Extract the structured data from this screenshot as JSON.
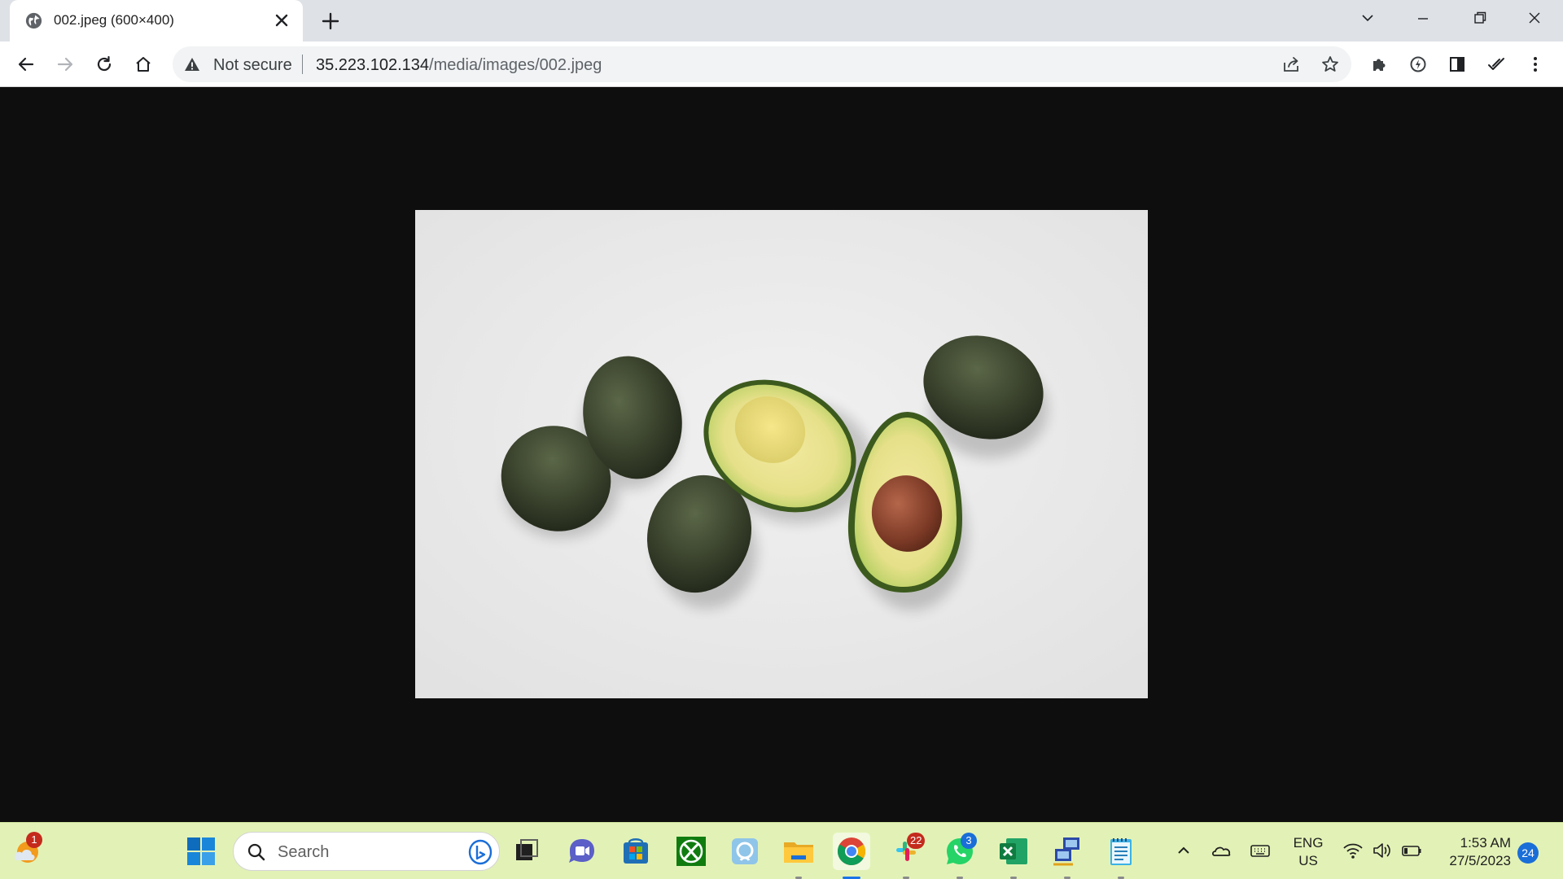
{
  "browser": {
    "tab": {
      "title": "002.jpeg (600×400)",
      "favicon": "globe-icon"
    },
    "omnibox": {
      "security_label": "Not secure",
      "url_host": "35.223.102.134",
      "url_path": "/media/images/002.jpeg"
    },
    "toolbar_icons": [
      "back-arrow-icon",
      "forward-arrow-icon",
      "reload-icon",
      "home-icon",
      "share-icon",
      "star-icon",
      "puzzle-extensions-icon",
      "lightning-extension-icon",
      "side-panel-icon",
      "checkmark-extension-icon",
      "kebab-menu-icon"
    ]
  },
  "content": {
    "image_description_icon": "avocado-photo"
  },
  "taskbar": {
    "weather_badge": "1",
    "search_label": "Search",
    "apps": [
      "windows-start-icon",
      "task-view-icon",
      "teams-chat-icon",
      "microsoft-store-icon",
      "xbox-icon",
      "photos-icon",
      "file-explorer-icon",
      "chrome-icon",
      "slack-icon",
      "whatsapp-icon",
      "excel-icon",
      "network-app-icon",
      "notepad-icon"
    ],
    "slack_badge": "22",
    "whatsapp_badge": "3",
    "language_line1": "ENG",
    "language_line2": "US",
    "time": "1:53 AM",
    "date": "27/5/2023",
    "notification_count": "24"
  },
  "colors": {
    "viewport_background": "#0e0e0e",
    "taskbar_background": "#e2f2b6",
    "tab_strip": "#dee1e6",
    "badge_red": "#c42b1c",
    "badge_blue": "#1a6ed8"
  }
}
